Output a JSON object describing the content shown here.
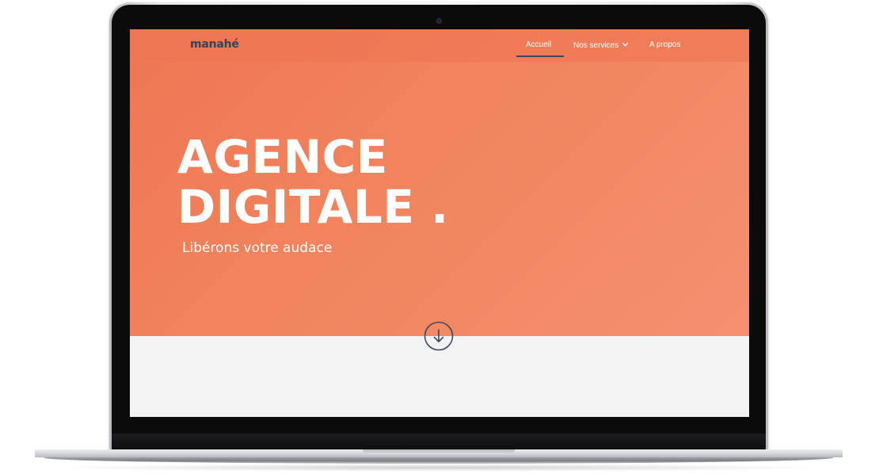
{
  "site": {
    "logo": "manahé",
    "nav": {
      "items": [
        {
          "label": "Accueil",
          "active": true
        },
        {
          "label": "Nos services",
          "has_dropdown": true
        },
        {
          "label": "A propos"
        }
      ]
    },
    "hero": {
      "headline_line1": "AGENCE",
      "headline_line2": "DIGITALE .",
      "tagline": "Libérons votre audace",
      "scroll_icon": "arrow-down-circle-icon"
    }
  },
  "colors": {
    "hero_orange": "#ee7752",
    "hero_orange_light": "#f49070",
    "logo_navy": "#33435a",
    "nav_underline": "#3b4a61",
    "lower_section_bg": "#f3f3f4"
  }
}
